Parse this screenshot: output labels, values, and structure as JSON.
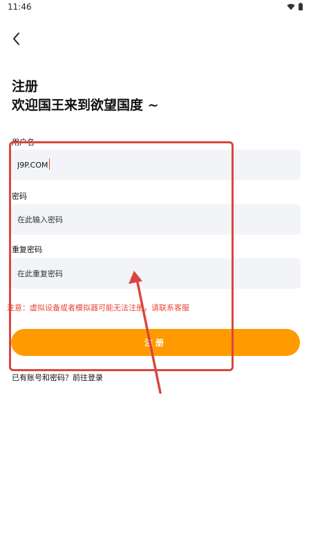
{
  "status_bar": {
    "time": "11:46",
    "icons": [
      "wifi-icon",
      "battery-icon"
    ]
  },
  "header": {
    "back_icon": "chevron-left-icon",
    "title": "注册",
    "subtitle": "欢迎国王来到欲望国度 ~"
  },
  "form": {
    "username_label": "用户名",
    "username_value": "J9P.COM",
    "password_label": "密码",
    "password_placeholder": "在此输入密码",
    "confirm_label": "重复密码",
    "confirm_placeholder": "在此重复密码",
    "notice": "注意：虚拟设备或者模拟器可能无法注册，请联系客服",
    "submit_label": "注册",
    "login_link": "已有账号和密码？前往登录"
  },
  "colors": {
    "accent": "#ff9a00",
    "notice": "#e8453c",
    "annotation": "#d9463e",
    "field_bg": "#f2f4f8"
  }
}
